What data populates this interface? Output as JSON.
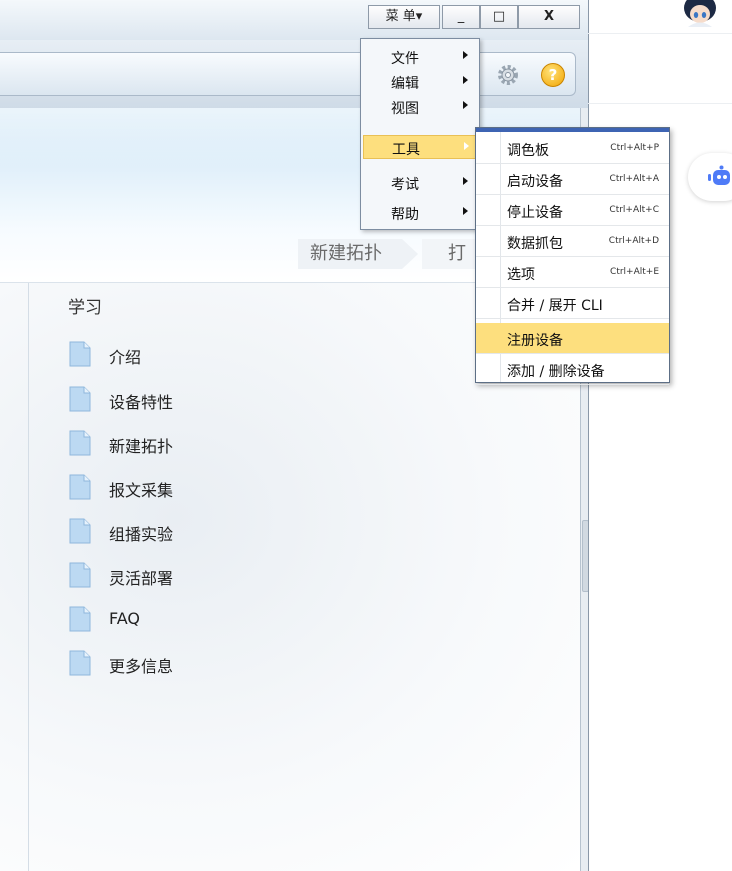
{
  "window": {
    "menu_button": "菜 单▾",
    "minimize": "_",
    "maximize": "□",
    "close": "X"
  },
  "breadcrumb": {
    "new_topology": "新建拓扑",
    "open_partial": "打"
  },
  "learn": {
    "title": "学习",
    "items": [
      {
        "label": "介绍"
      },
      {
        "label": "设备特性"
      },
      {
        "label": "新建拓扑"
      },
      {
        "label": "报文采集"
      },
      {
        "label": "组播实验"
      },
      {
        "label": "灵活部署"
      },
      {
        "label": "FAQ"
      },
      {
        "label": "更多信息"
      }
    ]
  },
  "menu": {
    "items": [
      {
        "label": "文件"
      },
      {
        "label": "编辑"
      },
      {
        "label": "视图"
      },
      {
        "label": "工具",
        "active": true
      },
      {
        "label": "考试"
      },
      {
        "label": "帮助"
      }
    ]
  },
  "tools_submenu": {
    "items": [
      {
        "label": "调色板",
        "shortcut": "Ctrl+Alt+P"
      },
      {
        "label": "启动设备",
        "shortcut": "Ctrl+Alt+A"
      },
      {
        "label": "停止设备",
        "shortcut": "Ctrl+Alt+C"
      },
      {
        "label": "数据抓包",
        "shortcut": "Ctrl+Alt+D"
      },
      {
        "label": "选项",
        "shortcut": "Ctrl+Alt+E"
      },
      {
        "label": "合并 / 展开 CLI",
        "shortcut": ""
      },
      {
        "label": "注册设备",
        "shortcut": "",
        "active": true
      },
      {
        "label": "添加 / 删除设备",
        "shortcut": ""
      }
    ]
  },
  "colors": {
    "highlight": "#fddf7e",
    "menu_border": "#7d8da1",
    "submenu_topbar": "#3e64b3",
    "doc_icon": "#bcd9f2"
  },
  "icons": {
    "gear": "gear-icon",
    "help": "help-icon",
    "doc": "document-icon",
    "assistant": "assistant-robot-icon",
    "avatar": "avatar"
  }
}
